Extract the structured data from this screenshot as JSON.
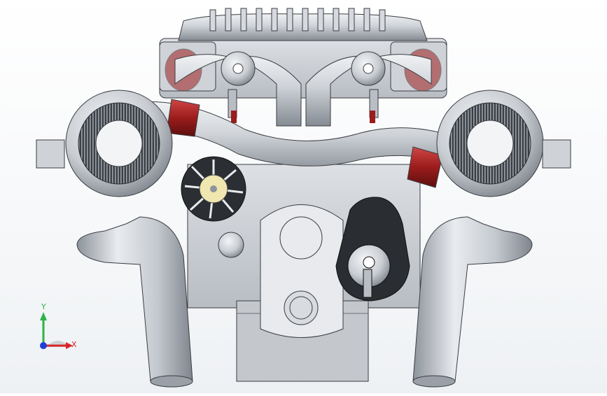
{
  "viewport": {
    "background": "#ffffff",
    "model_colors": {
      "metal": "#c7cbd1",
      "metal_dark": "#8e949c",
      "outline": "#3a3d42",
      "coupler": "#9b1c1c",
      "filter_pleat": "#2b2e33",
      "filter_face": "#f3f4f6",
      "pulley_dark": "#1f2226",
      "fan_hub": "#efe6b0"
    }
  },
  "triad": {
    "y_label": "Y",
    "x_label": "X",
    "y_color": "#2db34a",
    "x_color": "#d8262a",
    "z_color": "#1f3fd6"
  }
}
